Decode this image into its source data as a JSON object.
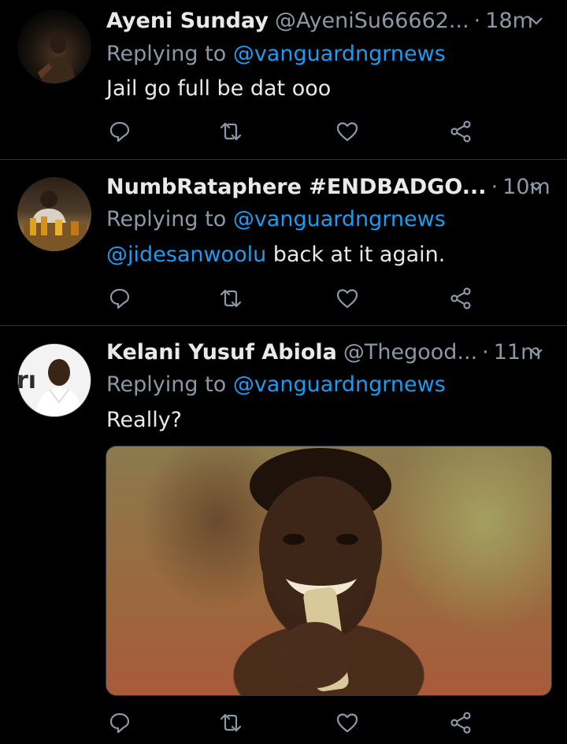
{
  "tweets": [
    {
      "name": "Ayeni Sunday",
      "handle": "@AyeniSu66662...",
      "separator": "·",
      "time": "18m",
      "replying_prefix": "Replying to",
      "replying_to": "@vanguardngrnews",
      "text": "Jail go full be dat ooo"
    },
    {
      "name": "NumbRataphere #ENDBADGO...",
      "handle": "",
      "separator": "·",
      "time": "10m",
      "replying_prefix": "Replying to",
      "replying_to": "@vanguardngrnews",
      "text_mention": "@jidesanwoolu",
      "text": " back at it again."
    },
    {
      "name": "Kelani Yusuf Abiola",
      "handle": "@Thegood...",
      "separator": "·",
      "time": "11m",
      "replying_prefix": "Replying to",
      "replying_to": "@vanguardngrnews",
      "text": "Really?",
      "avatar_text": "rı"
    }
  ],
  "colors": {
    "background": "#000000",
    "text": "#e7e9ea",
    "secondary": "#8b98a5",
    "link": "#1d9bf0",
    "divider": "#2f3336"
  },
  "icons": [
    "reply-icon",
    "retweet-icon",
    "like-icon",
    "share-icon",
    "chevron-down-icon"
  ]
}
